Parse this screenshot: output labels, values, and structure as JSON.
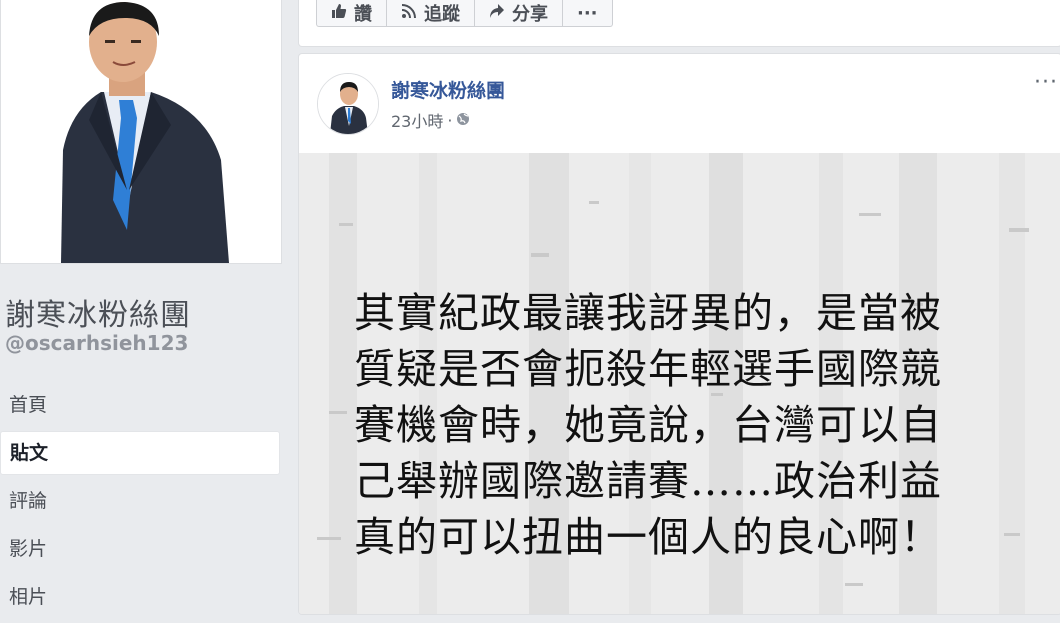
{
  "sidebar": {
    "page_name": "謝寒冰粉絲團",
    "handle": "@oscarhsieh123",
    "nav": [
      {
        "label": "首頁",
        "active": false
      },
      {
        "label": "貼文",
        "active": true
      },
      {
        "label": "評論",
        "active": false
      },
      {
        "label": "影片",
        "active": false
      },
      {
        "label": "相片",
        "active": false
      }
    ]
  },
  "actions": {
    "like_label": "讚",
    "follow_label": "追蹤",
    "share_label": "分享",
    "more_label": "···"
  },
  "post": {
    "author": "謝寒冰粉絲團",
    "time": "23小時",
    "separator": "·",
    "text_lines": [
      "其實紀政最讓我訝異的，是當被",
      "質疑是否會扼殺年輕選手國際競",
      "賽機會時，她竟說，台灣可以自",
      "己舉辦國際邀請賽……政治利益",
      "真的可以扭曲一個人的良心啊！"
    ],
    "menu_label": "···"
  },
  "colors": {
    "link": "#365899",
    "background": "#e9ebee",
    "suit": "#2a3140",
    "tie": "#2f7fd6"
  },
  "icons": [
    "thumbs-up-icon",
    "rss-icon",
    "share-arrow-icon",
    "globe-icon"
  ]
}
